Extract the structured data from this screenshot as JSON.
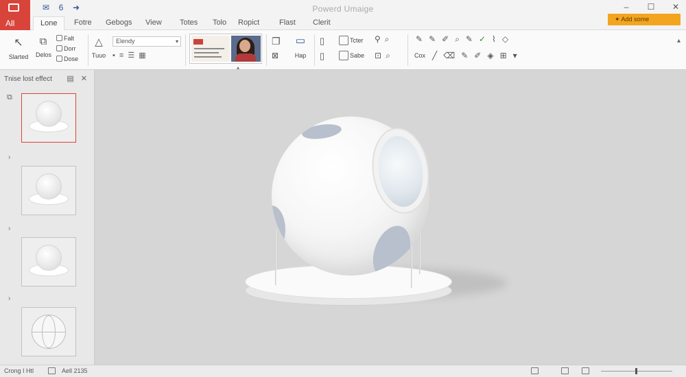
{
  "app": {
    "title": "Powerd Umaige",
    "file_tab": "All"
  },
  "quick_access": {
    "icons": [
      "save-icon",
      "undo-icon",
      "redo-icon"
    ],
    "undo_glyph": "6",
    "redo_glyph": "➜"
  },
  "tabs": [
    "Lone",
    "Fotre",
    "Gebogs",
    "View",
    "Totes",
    "Tolo",
    "Ropict",
    "Flast",
    "Clerit"
  ],
  "active_tab": "Lone",
  "addin_button": "Add some",
  "ribbon": {
    "new_slide": "Slarted",
    "delete": "Delos",
    "small_buttons": [
      "Falt",
      "Dorr",
      "Dose"
    ],
    "text_tool": "Tuuo",
    "font_name": "Elendy",
    "shapes_label": "Hap",
    "tools": [
      "Tcter",
      "Sabe"
    ],
    "edit_label": "Cox"
  },
  "pane": {
    "title": "Tnise lost effect",
    "thumbnails": [
      {
        "kind": "sphere",
        "selected": true
      },
      {
        "kind": "sphere",
        "selected": false
      },
      {
        "kind": "sphere",
        "selected": false
      },
      {
        "kind": "globe",
        "selected": false
      }
    ]
  },
  "statusbar": {
    "slide_info": "Crong I Htl",
    "notes": "Aell 2135"
  },
  "colors": {
    "accent_red": "#d9443a",
    "addin_orange": "#f3a51f",
    "canvas_bg": "#d6d6d6"
  }
}
